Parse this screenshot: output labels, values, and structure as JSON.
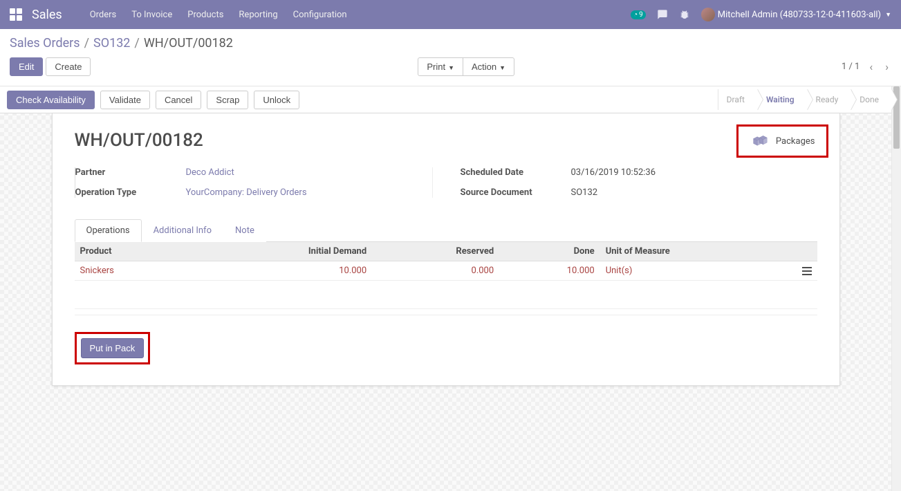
{
  "brand": "Sales",
  "topnav": {
    "orders": "Orders",
    "to_invoice": "To Invoice",
    "products": "Products",
    "reporting": "Reporting",
    "configuration": "Configuration"
  },
  "systray": {
    "clock_badge": "9",
    "user": "Mitchell Admin (480733-12-0-411603-all)"
  },
  "breadcrumb": {
    "root": "Sales Orders",
    "level1": "SO132",
    "current": "WH/OUT/00182"
  },
  "controlbar": {
    "edit": "Edit",
    "create": "Create",
    "print": "Print",
    "action": "Action",
    "pager": "1 / 1"
  },
  "statusbar": {
    "check_availability": "Check Availability",
    "validate": "Validate",
    "cancel": "Cancel",
    "scrap": "Scrap",
    "unlock": "Unlock",
    "steps": {
      "draft": "Draft",
      "waiting": "Waiting",
      "ready": "Ready",
      "done": "Done"
    }
  },
  "sheet": {
    "title": "WH/OUT/00182",
    "packages_label": "Packages",
    "fields": {
      "partner_label": "Partner",
      "partner_value": "Deco Addict",
      "operation_type_label": "Operation Type",
      "operation_type_value": "YourCompany: Delivery Orders",
      "scheduled_date_label": "Scheduled Date",
      "scheduled_date_value": "03/16/2019 10:52:36",
      "source_doc_label": "Source Document",
      "source_doc_value": "SO132"
    },
    "tabs": {
      "operations": "Operations",
      "additional_info": "Additional Info",
      "note": "Note"
    },
    "table": {
      "headers": {
        "product": "Product",
        "initial_demand": "Initial Demand",
        "reserved": "Reserved",
        "done": "Done",
        "uom": "Unit of Measure"
      },
      "row0": {
        "product": "Snickers",
        "initial_demand": "10.000",
        "reserved": "0.000",
        "done": "10.000",
        "uom": "Unit(s)"
      }
    },
    "put_in_pack": "Put in Pack"
  }
}
